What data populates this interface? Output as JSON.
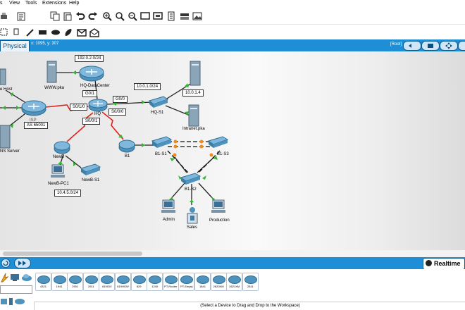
{
  "menu": [
    "s",
    "View",
    "Tools",
    "Extensions",
    "Help"
  ],
  "toolbar1_icons": [
    "copy-icon",
    "paste-icon",
    "undo-icon",
    "redo-icon",
    "zoom-in-icon",
    "zoom-out-icon",
    "zoom-reset-icon",
    "window-icon",
    "custom-device-icon",
    "palette-icon",
    "image-icon",
    "document-icon"
  ],
  "toolbar2_icons": [
    "select-icon",
    "note-icon",
    "pencil-icon",
    "rectangle-icon",
    "ellipse-icon",
    "freeform-icon",
    "pdu-icon",
    "complex-pdu-icon"
  ],
  "tabs": {
    "physical": "Physical",
    "coords": "x: 1095, y: 307",
    "root": "[Root]"
  },
  "network": {
    "labels": {
      "host": "e Host",
      "dns": "NS Server",
      "isp": "ISP",
      "www": "WWW.pka",
      "dc": "HQ-DataCenter",
      "hq": "HQ",
      "hqs1": "HQ-S1",
      "intranet": "Intranet.pka",
      "newb": "NewB",
      "newbpc": "NewB-PC1",
      "newbs1": "NewB-S1",
      "b1": "B1",
      "b1s1": "B1-S1",
      "b1s2": "B1-S2",
      "b1s3": "B1-S3",
      "admin": "Admin",
      "sales": "Sales",
      "prod": "Production"
    },
    "boxes": {
      "net1": "192.0.2.0/24",
      "g01": "G0/1",
      "s010": "S0/1/0",
      "g00": "G0/0",
      "s000": "S0/0/0",
      "s001": "S0/0/1",
      "as": "AS 65001",
      "net2": "10.0.1.0/24",
      "ip": "10.0.1.4",
      "net3": "10.4.5.0/24"
    }
  },
  "bottom": {
    "realtime": "Realtime"
  },
  "palette": {
    "devices": [
      "4321",
      "1941",
      "2901",
      "2911",
      "819IOX",
      "819HGW",
      "829",
      "1240",
      "PT-Router",
      "PT-Empty",
      "1841",
      "2620XM",
      "2621XM",
      "2811"
    ],
    "status": "(Select a Device to Drag and Drop to the Workspace)"
  },
  "colors": {
    "accent": "#1e8fd6",
    "router": "#4d93bd",
    "serial_link": "#e0201b",
    "link_ok": "#2fb82f",
    "link_blocked": "#f08a1c"
  }
}
